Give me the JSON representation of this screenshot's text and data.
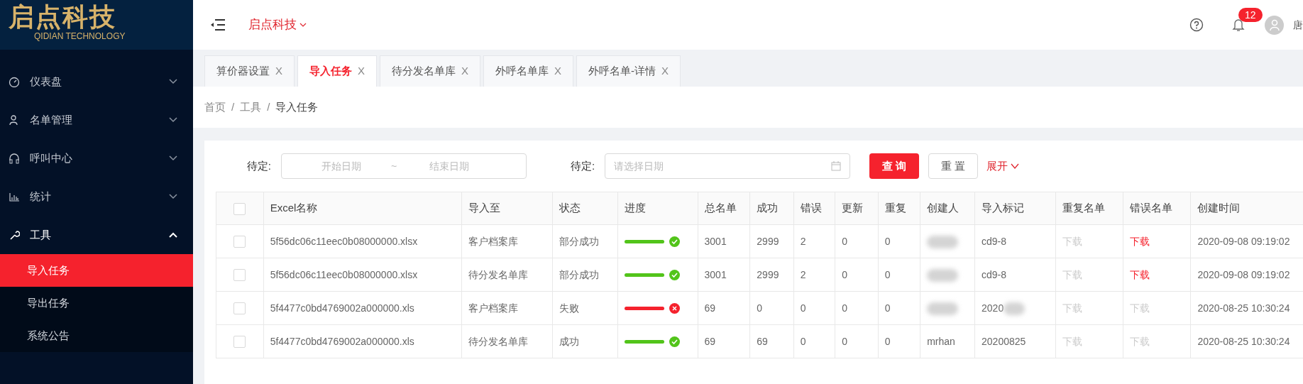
{
  "logo": {
    "name": "启点科技",
    "subtitle": "QIDIAN TECHNOLOGY"
  },
  "sidebar": {
    "items": [
      {
        "label": "仪表盘",
        "kind": "gauge",
        "expanded": false
      },
      {
        "label": "名单管理",
        "kind": "users",
        "expanded": false
      },
      {
        "label": "呼叫中心",
        "kind": "headset",
        "expanded": false
      },
      {
        "label": "统计",
        "kind": "chart",
        "expanded": false
      },
      {
        "label": "工具",
        "kind": "wrench",
        "expanded": true,
        "children": [
          {
            "label": "导入任务",
            "selected": true
          },
          {
            "label": "导出任务",
            "selected": false
          },
          {
            "label": "系统公告",
            "selected": false
          }
        ]
      }
    ]
  },
  "header": {
    "company": "启点科技",
    "notifications": "12",
    "user": "唐"
  },
  "tabs": [
    {
      "label": "算价器设置",
      "close": "X",
      "selected": false
    },
    {
      "label": "导入任务",
      "close": "X",
      "selected": true
    },
    {
      "label": "待分发名单库",
      "close": "X",
      "selected": false
    },
    {
      "label": "外呼名单库",
      "close": "X",
      "selected": false
    },
    {
      "label": "外呼名单-详情",
      "close": "X",
      "selected": false
    }
  ],
  "breadcrumb": [
    {
      "label": "首页",
      "separator": "/"
    },
    {
      "label": "工具",
      "separator": "/"
    },
    {
      "label": "导入任务"
    }
  ],
  "filters": {
    "label_1": "待定:",
    "start_placeholder": "开始日期",
    "separator": "~",
    "end_placeholder": "结束日期",
    "label_2": "待定:",
    "date_placeholder": "请选择日期",
    "search": "查 询",
    "reset": "重 置",
    "expand": "展开"
  },
  "table": {
    "all_checked": false,
    "columns": [
      "Excel名称",
      "导入至",
      "状态",
      "进度",
      "总名单",
      "成功",
      "错误",
      "更新",
      "重复",
      "创建人",
      "导入标记",
      "重复名单",
      "错误名单",
      "创建时间"
    ],
    "rows": [
      {
        "checked": false,
        "file": "5f56dc06c11eec0b08000000.xlsx",
        "target": "客户档案库",
        "status": "部分成功",
        "failed": false,
        "level": 1,
        "total": "3001",
        "success": "2999",
        "errors": "2",
        "updated": "0",
        "duplicates": "0",
        "creator_redacted": true,
        "mark": "cd9-8",
        "dup_list": {
          "label": "下载",
          "enabled": false
        },
        "err_list": {
          "label": "下载",
          "enabled": true
        },
        "created": "2020-09-08 09:19:02"
      },
      {
        "checked": false,
        "file": "5f56dc06c11eec0b08000000.xlsx",
        "target": "待分发名单库",
        "status": "部分成功",
        "failed": false,
        "level": 1,
        "total": "3001",
        "success": "2999",
        "errors": "2",
        "updated": "0",
        "duplicates": "0",
        "creator_redacted": true,
        "mark": "cd9-8",
        "dup_list": {
          "label": "下载",
          "enabled": false
        },
        "err_list": {
          "label": "下载",
          "enabled": true
        },
        "created": "2020-09-08 09:19:02"
      },
      {
        "checked": false,
        "file": "5f4477c0bd4769002a000000.xls",
        "target": "客户档案库",
        "status": "失败",
        "failed": true,
        "level": 1,
        "total": "69",
        "success": "0",
        "errors": "0",
        "updated": "0",
        "duplicates": "0",
        "creator_redacted": true,
        "mark": "2020",
        "mark_redacted": true,
        "dup_list": {
          "label": "下载",
          "enabled": false
        },
        "err_list": {
          "label": "下载",
          "enabled": false
        },
        "created": "2020-08-25 10:30:24"
      },
      {
        "checked": false,
        "file": "5f4477c0bd4769002a000000.xls",
        "target": "待分发名单库",
        "status": "成功",
        "failed": false,
        "level": 1,
        "total": "69",
        "success": "69",
        "errors": "0",
        "updated": "0",
        "duplicates": "0",
        "creator": "mrhan",
        "mark": "20200825",
        "dup_list": {
          "label": "下载",
          "enabled": false
        },
        "err_list": {
          "label": "下载",
          "enabled": false
        },
        "created": "2020-08-25 10:30:24"
      }
    ]
  }
}
